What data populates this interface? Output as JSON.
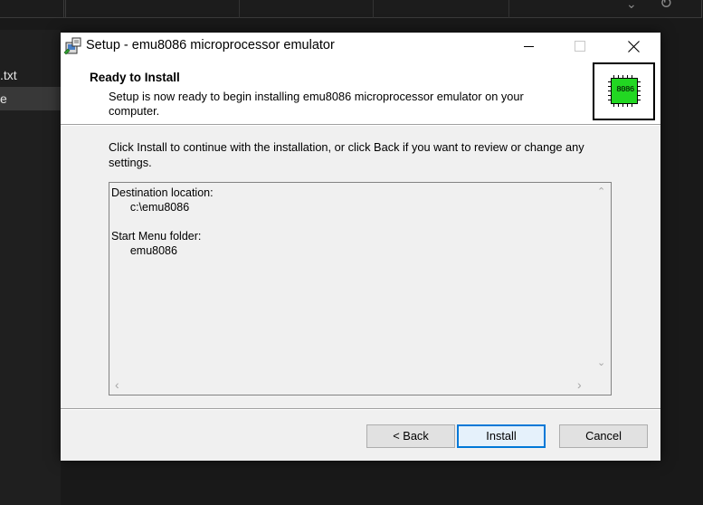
{
  "background": {
    "file_items": [
      ".txt",
      "e"
    ]
  },
  "dialog": {
    "title": "Setup - emu8086 microprocessor emulator",
    "header": {
      "page_title": "Ready to Install",
      "description": "Setup is now ready to begin installing emu8086 microprocessor emulator on your computer.",
      "image_label": "8086"
    },
    "instruction": "Click Install to continue with the installation, or click Back if you want to review or change any settings.",
    "memo": {
      "text": "Destination location:\n      c:\\emu8086\n\nStart Menu folder:\n      emu8086"
    },
    "buttons": {
      "back": "< Back",
      "install": "Install",
      "cancel": "Cancel"
    }
  },
  "colors": {
    "chip_green": "#22d722",
    "default_button_border": "#0078d7"
  }
}
